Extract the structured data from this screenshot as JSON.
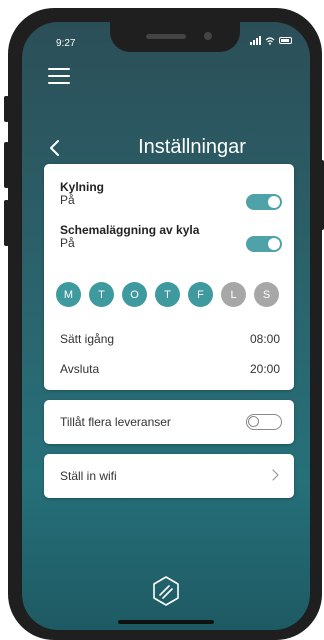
{
  "status_bar": {
    "time": "9:27"
  },
  "header": {
    "title": "Inställningar"
  },
  "cooling": {
    "title": "Kylning",
    "value": "På",
    "enabled": true
  },
  "schedule": {
    "title": "Schemaläggning av kyla",
    "value": "På",
    "enabled": true
  },
  "days": [
    {
      "label": "M",
      "active": true
    },
    {
      "label": "T",
      "active": true
    },
    {
      "label": "O",
      "active": true
    },
    {
      "label": "T",
      "active": true
    },
    {
      "label": "F",
      "active": true
    },
    {
      "label": "L",
      "active": false
    },
    {
      "label": "S",
      "active": false
    }
  ],
  "start": {
    "label": "Sätt igång",
    "value": "08:00"
  },
  "end": {
    "label": "Avsluta",
    "value": "20:00"
  },
  "deliveries": {
    "label": "Tillåt flera leveranser",
    "enabled": false
  },
  "wifi": {
    "label": "Ställ in wifi"
  },
  "colors": {
    "accent": "#3f9aa0",
    "toggle_on": "#4fa3a8",
    "day_inactive": "#a7a7a7",
    "background": "#26707a"
  }
}
